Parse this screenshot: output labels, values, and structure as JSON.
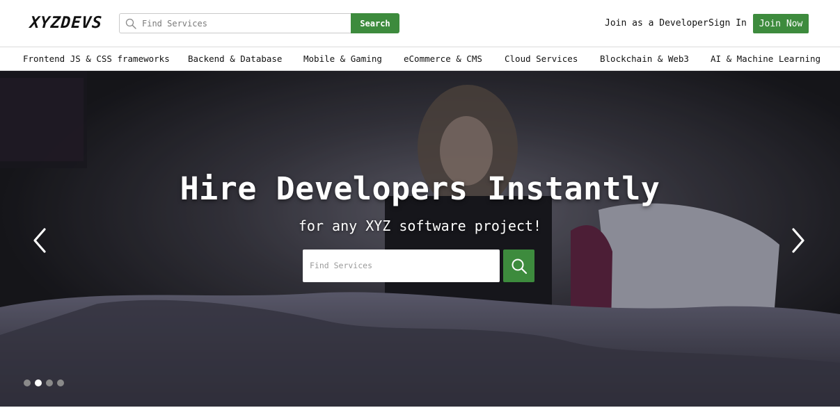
{
  "header": {
    "logo": "XYZDEVS",
    "search": {
      "placeholder": "Find Services",
      "button_label": "Search"
    },
    "links": {
      "join_developer": "Join as a Developer",
      "sign_in": "Sign In",
      "join_now": "Join Now"
    }
  },
  "categories": [
    "Frontend JS & CSS frameworks",
    "Backend & Database",
    "Mobile & Gaming",
    "eCommerce & CMS",
    "Cloud Services",
    "Blockchain & Web3",
    "AI & Machine Learning"
  ],
  "hero": {
    "title": "Hire Developers Instantly",
    "subtitle": "for any XYZ software project!",
    "search_placeholder": "Find Services",
    "carousel": {
      "slide_count": 4,
      "active_slide": 2
    }
  },
  "colors": {
    "accent": "#3d8b3d",
    "text": "#111111",
    "divider": "#dcdcdc"
  },
  "icons": [
    "search-icon",
    "chevron-left-icon",
    "chevron-right-icon"
  ]
}
